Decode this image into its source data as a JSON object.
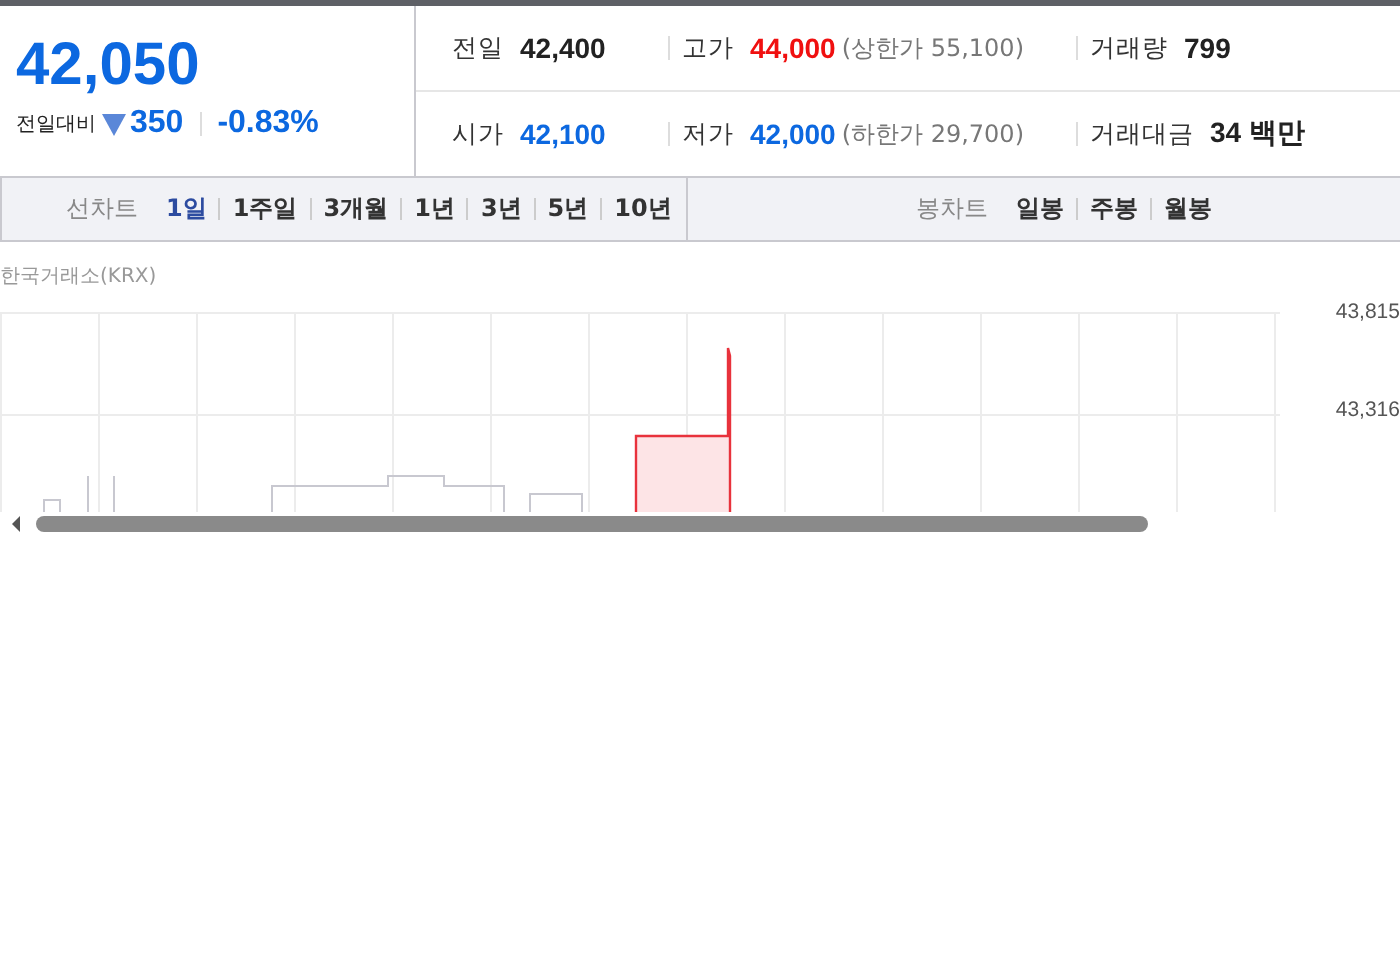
{
  "quote": {
    "price": "42,050",
    "change_label": "전일대비",
    "kind": "down",
    "color": "#0c68e0",
    "change": "350",
    "rate": "-0.83%"
  },
  "stats": [
    [
      {
        "label": "전일",
        "value": "42,400",
        "color": "#222222"
      },
      {
        "label": "고가",
        "value": "44,000",
        "color": "#f01010",
        "note": "(상한가 55,100)"
      },
      {
        "label": "거래량",
        "value": "799",
        "color": "#222222"
      }
    ],
    [
      {
        "label": "시가",
        "value": "42,100",
        "color": "#0c68e0"
      },
      {
        "label": "저가",
        "value": "42,000",
        "color": "#0c68e0",
        "note": "(하한가 29,700)"
      },
      {
        "label": "거래대금",
        "value": "34 백만",
        "color": "#222222"
      }
    ]
  ],
  "line_chart": {
    "label": "선차트",
    "periods": [
      {
        "label": "1일",
        "selected": true
      },
      {
        "label": "1주일",
        "selected": false
      },
      {
        "label": "3개월",
        "selected": false
      },
      {
        "label": "1년",
        "selected": false
      },
      {
        "label": "3년",
        "selected": false
      },
      {
        "label": "5년",
        "selected": false
      },
      {
        "label": "10년",
        "selected": false
      }
    ]
  },
  "candle_chart": {
    "label": "봉차트",
    "periods": [
      {
        "label": "일봉",
        "selected": false
      },
      {
        "label": "주봉",
        "selected": false
      },
      {
        "label": "월봉",
        "selected": false
      }
    ]
  },
  "chart": {
    "source": "한국거래소(KRX)",
    "y_labels": [
      "43,815",
      "43,316"
    ]
  }
}
